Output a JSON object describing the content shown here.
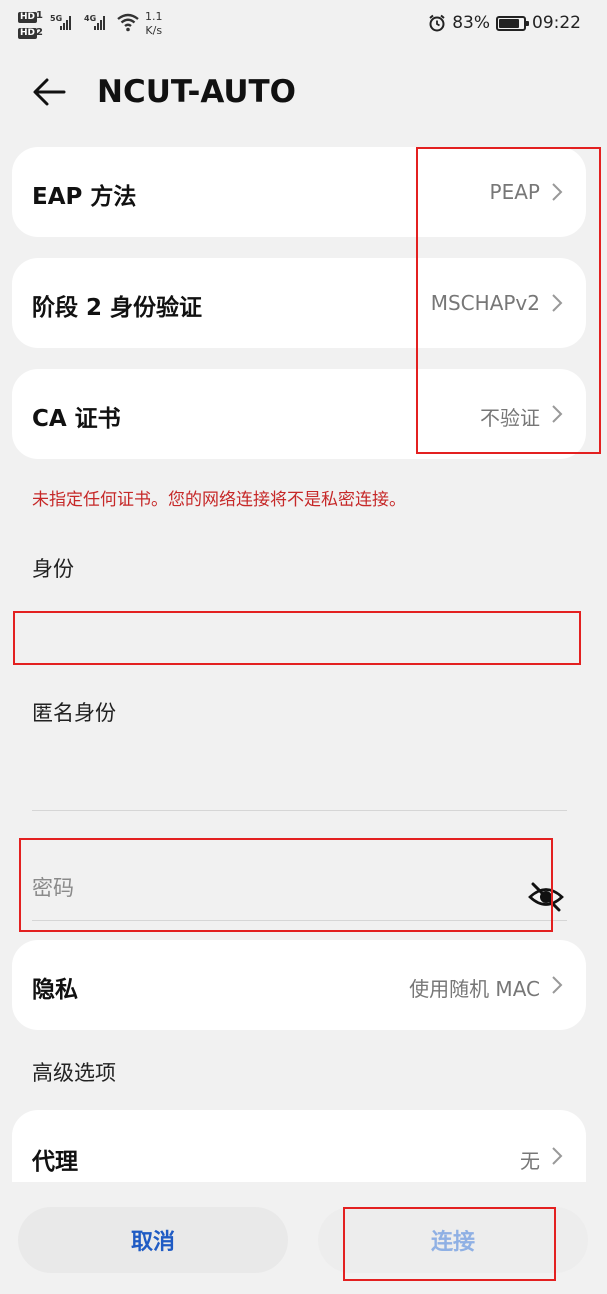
{
  "status_bar": {
    "hd1": "HD",
    "hd1_num": "1",
    "hd2": "HD",
    "hd2_num": "2",
    "net1": "5G",
    "net2": "4G",
    "speed_value": "1.1",
    "speed_unit": "K/s",
    "battery": "83%",
    "battery_level": 0.83,
    "time": "09:22"
  },
  "header": {
    "title": "NCUT-AUTO",
    "back_icon": "arrow-left-icon"
  },
  "eap": {
    "label": "EAP 方法",
    "value": "PEAP"
  },
  "phase2": {
    "label": "阶段 2 身份验证",
    "value": "MSCHAPv2"
  },
  "ca": {
    "label": "CA 证书",
    "value": "不验证"
  },
  "warning": "未指定任何证书。您的网络连接将不是私密连接。",
  "identity": {
    "label": "身份",
    "value": ""
  },
  "anonymous": {
    "label": "匿名身份",
    "value": ""
  },
  "password": {
    "placeholder": "密码",
    "visibility_icon": "eye-off-icon"
  },
  "privacy": {
    "label": "隐私",
    "value": "使用随机 MAC"
  },
  "advanced": {
    "label": "高级选项"
  },
  "proxy": {
    "label": "代理",
    "value": "无"
  },
  "buttons": {
    "cancel": "取消",
    "connect": "连接"
  },
  "colors": {
    "accent": "#1f5bc4",
    "warning": "#c62828",
    "highlight": "#e32020"
  }
}
